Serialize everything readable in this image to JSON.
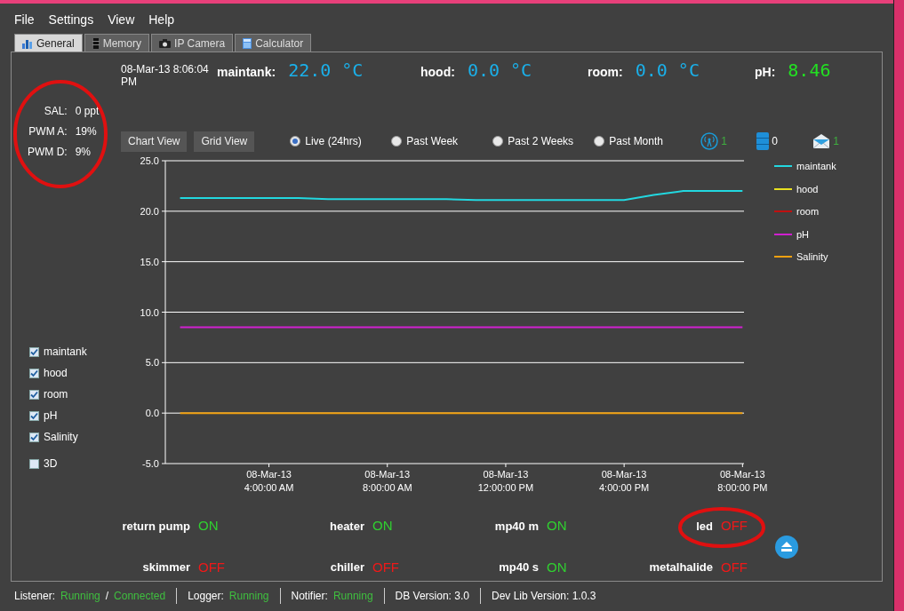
{
  "menu": [
    "File",
    "Settings",
    "View",
    "Help"
  ],
  "tabs": [
    {
      "label": "General",
      "selected": true
    },
    {
      "label": "Memory",
      "selected": false
    },
    {
      "label": "IP Camera",
      "selected": false
    },
    {
      "label": "Calculator",
      "selected": false
    }
  ],
  "stats": [
    {
      "label": "SAL:",
      "value": "0 ppt"
    },
    {
      "label": "PWM A:",
      "value": "19%"
    },
    {
      "label": "PWM D:",
      "value": "9%"
    }
  ],
  "series_toggles": [
    {
      "label": "maintank",
      "checked": true
    },
    {
      "label": "hood",
      "checked": true
    },
    {
      "label": "room",
      "checked": true
    },
    {
      "label": "pH",
      "checked": true
    },
    {
      "label": "Salinity",
      "checked": true
    },
    {
      "label": "3D",
      "checked": false
    }
  ],
  "datetime": "08-Mar-13 8:06:04 PM",
  "readings": [
    {
      "label": "maintank:",
      "value": "22.0 °C",
      "kind": "temperature"
    },
    {
      "label": "hood:",
      "value": "0.0 °C",
      "kind": "temperature"
    },
    {
      "label": "room:",
      "value": "0.0 °C",
      "kind": "temperature"
    },
    {
      "label": "pH:",
      "value": "8.46",
      "kind": "ph"
    }
  ],
  "view_buttons": [
    "Chart View",
    "Grid View"
  ],
  "ranges": [
    {
      "label": "Live (24hrs)",
      "selected": true
    },
    {
      "label": "Past Week",
      "selected": false
    },
    {
      "label": "Past 2 Weeks",
      "selected": false
    },
    {
      "label": "Past Month",
      "selected": false
    }
  ],
  "counters": [
    {
      "value": "1",
      "color": "#3fae3f"
    },
    {
      "value": "0",
      "color": "#ffffff"
    },
    {
      "value": "1",
      "color": "#3fae3f"
    }
  ],
  "chart_data": {
    "type": "line",
    "categories": [
      null,
      null,
      null,
      null,
      "08-Mar-13 4:00:00 AM",
      null,
      null,
      null,
      "08-Mar-13 8:00:00 AM",
      null,
      null,
      null,
      "08-Mar-13 12:00:00 PM",
      null,
      null,
      null,
      "08-Mar-13 4:00:00 PM",
      null,
      null,
      null,
      "08-Mar-13 8:00:00 PM"
    ],
    "series": [
      {
        "name": "maintank",
        "color": "#22d8e0",
        "values": [
          null,
          21.3,
          21.3,
          21.3,
          21.3,
          21.3,
          21.2,
          21.2,
          21.2,
          21.2,
          21.2,
          21.1,
          21.1,
          21.1,
          21.1,
          21.1,
          21.1,
          21.6,
          22.0,
          22.0,
          22.0
        ]
      },
      {
        "name": "hood",
        "color": "#e8e020",
        "values": [
          null,
          null,
          null,
          null,
          null,
          null,
          null,
          null,
          null,
          null,
          null,
          null,
          null,
          null,
          null,
          null,
          null,
          null,
          null,
          null,
          null
        ]
      },
      {
        "name": "room",
        "color": "#c01010",
        "values": [
          null,
          null,
          null,
          null,
          null,
          null,
          null,
          null,
          null,
          null,
          null,
          null,
          null,
          null,
          null,
          null,
          null,
          null,
          null,
          null,
          null
        ]
      },
      {
        "name": "pH",
        "color": "#d020d0",
        "values": [
          null,
          8.5,
          8.5,
          8.5,
          8.5,
          8.5,
          8.5,
          8.5,
          8.5,
          8.5,
          8.5,
          8.5,
          8.5,
          8.5,
          8.5,
          8.5,
          8.5,
          8.5,
          8.5,
          8.5,
          8.5
        ]
      },
      {
        "name": "Salinity",
        "color": "#f0a010",
        "values": [
          null,
          0,
          0,
          0,
          0,
          0,
          0,
          0,
          0,
          0,
          0,
          0,
          0,
          0,
          0,
          0,
          0,
          0,
          0,
          0,
          0
        ]
      }
    ],
    "ylim": [
      -5,
      25
    ],
    "grid": true,
    "yticks": [
      {
        "value": 25,
        "label": "25.0"
      },
      {
        "value": 20,
        "label": "20.0"
      },
      {
        "value": 15,
        "label": "15.0"
      },
      {
        "value": 10,
        "label": "10.0"
      },
      {
        "value": 5,
        "label": "5.0"
      },
      {
        "value": 0,
        "label": "0.0"
      },
      {
        "value": -5,
        "label": "-5.0"
      }
    ]
  },
  "switches": [
    {
      "label": "return pump",
      "state": "ON",
      "on": true
    },
    {
      "label": "heater",
      "state": "ON",
      "on": true
    },
    {
      "label": "mp40 m",
      "state": "ON",
      "on": true
    },
    {
      "label": "led",
      "state": "OFF",
      "on": false
    },
    {
      "label": "skimmer",
      "state": "OFF",
      "on": false
    },
    {
      "label": "chiller",
      "state": "OFF",
      "on": false
    },
    {
      "label": "mp40 s",
      "state": "ON",
      "on": true
    },
    {
      "label": "metalhalide",
      "state": "OFF",
      "on": false
    }
  ],
  "status_bar": [
    {
      "parts": [
        {
          "text": "Listener:",
          "kind": "label"
        },
        {
          "text": "Running",
          "kind": "value"
        },
        {
          "text": "/",
          "kind": "label"
        },
        {
          "text": "Connected",
          "kind": "value"
        }
      ]
    },
    {
      "parts": [
        {
          "text": "Logger:",
          "kind": "label"
        },
        {
          "text": "Running",
          "kind": "value"
        }
      ]
    },
    {
      "parts": [
        {
          "text": "Notifier:",
          "kind": "label"
        },
        {
          "text": "Running",
          "kind": "value"
        }
      ]
    },
    {
      "parts": [
        {
          "text": "DB Version: 3.0",
          "kind": "label"
        }
      ]
    },
    {
      "parts": [
        {
          "text": "Dev Lib Version: 1.0.3",
          "kind": "label"
        }
      ]
    }
  ]
}
